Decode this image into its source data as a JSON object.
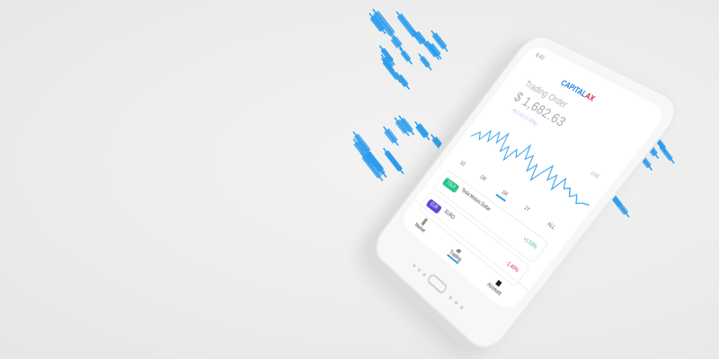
{
  "screen": {
    "status_time": "9:41",
    "logo_main": "CAPITAL",
    "logo_accent": "AX",
    "account_label": "Trading Order",
    "balance": "$ 1,682.63",
    "sub_text": "+$ 0.00 (0.00%)",
    "live_label": "LIVE"
  },
  "periods": [
    {
      "label": "1D"
    },
    {
      "label": "1W"
    },
    {
      "label": "1M"
    },
    {
      "label": "1Y"
    },
    {
      "label": "ALL"
    }
  ],
  "instruments": [
    {
      "badge": "TSLA",
      "name": "Tesla Motors Dollar",
      "change": "+1.53%"
    },
    {
      "badge": "EUR",
      "name": "EURO",
      "change": "-1.40%"
    }
  ],
  "tabs": [
    {
      "label": "Market",
      "icon": "market-icon"
    },
    {
      "label": "Trading",
      "icon": "trading-icon"
    },
    {
      "label": "Account",
      "icon": "account-icon"
    }
  ],
  "colors": {
    "candle_blue": "#2b9cec",
    "background": "#ececec",
    "up": "#2bc58a",
    "down": "#e0203a",
    "badge_purple": "#5a4bd6"
  }
}
